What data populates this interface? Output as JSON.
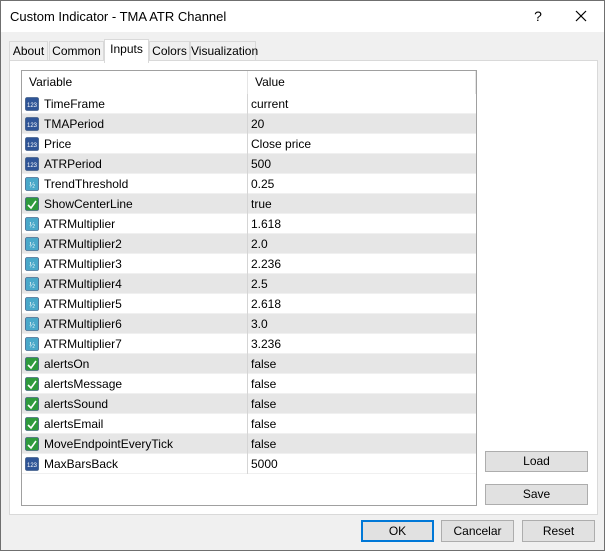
{
  "window": {
    "title": "Custom Indicator - TMA ATR Channel",
    "help_glyph": "?"
  },
  "tabs": [
    {
      "label": "About",
      "active": false
    },
    {
      "label": "Common",
      "active": false
    },
    {
      "label": "Inputs",
      "active": true
    },
    {
      "label": "Colors",
      "active": false
    },
    {
      "label": "Visualization",
      "active": false
    }
  ],
  "grid": {
    "headers": {
      "variable": "Variable",
      "value": "Value"
    },
    "rows": [
      {
        "icon": "int-type-icon",
        "name": "TimeFrame",
        "value": "current"
      },
      {
        "icon": "int-type-icon",
        "name": "TMAPeriod",
        "value": "20"
      },
      {
        "icon": "int-type-icon",
        "name": "Price",
        "value": "Close price"
      },
      {
        "icon": "int-type-icon",
        "name": "ATRPeriod",
        "value": "500"
      },
      {
        "icon": "double-type-icon",
        "name": "TrendThreshold",
        "value": "0.25"
      },
      {
        "icon": "bool-type-icon",
        "name": "ShowCenterLine",
        "value": "true"
      },
      {
        "icon": "double-type-icon",
        "name": "ATRMultiplier",
        "value": "1.618"
      },
      {
        "icon": "double-type-icon",
        "name": "ATRMultiplier2",
        "value": "2.0"
      },
      {
        "icon": "double-type-icon",
        "name": "ATRMultiplier3",
        "value": "2.236"
      },
      {
        "icon": "double-type-icon",
        "name": "ATRMultiplier4",
        "value": "2.5"
      },
      {
        "icon": "double-type-icon",
        "name": "ATRMultiplier5",
        "value": "2.618"
      },
      {
        "icon": "double-type-icon",
        "name": "ATRMultiplier6",
        "value": "3.0"
      },
      {
        "icon": "double-type-icon",
        "name": "ATRMultiplier7",
        "value": "3.236"
      },
      {
        "icon": "bool-type-icon",
        "name": "alertsOn",
        "value": "false"
      },
      {
        "icon": "bool-type-icon",
        "name": "alertsMessage",
        "value": "false"
      },
      {
        "icon": "bool-type-icon",
        "name": "alertsSound",
        "value": "false"
      },
      {
        "icon": "bool-type-icon",
        "name": "alertsEmail",
        "value": "false"
      },
      {
        "icon": "bool-type-icon",
        "name": "MoveEndpointEveryTick",
        "value": "false"
      },
      {
        "icon": "int-type-icon",
        "name": "MaxBarsBack",
        "value": "5000"
      }
    ]
  },
  "side_buttons": {
    "load": "Load",
    "save": "Save"
  },
  "bottom_buttons": {
    "ok": "OK",
    "cancel": "Cancelar",
    "reset": "Reset"
  },
  "colors": {
    "alt_row": "#e6e6e6",
    "default_button_border": "#0078d7",
    "int_icon": "#2f5597",
    "double_icon": "#4aa8c9",
    "bool_icon": "#2e9a3c"
  }
}
